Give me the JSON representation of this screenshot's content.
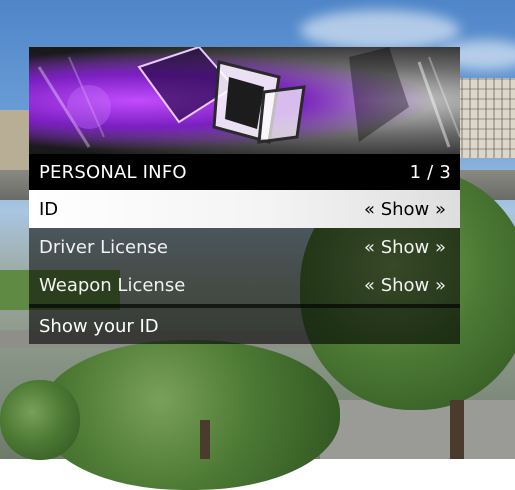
{
  "menu": {
    "title": "PERSONAL INFO",
    "counter": "1 / 3",
    "items": [
      {
        "label": "ID",
        "value": "« Show »",
        "selected": true
      },
      {
        "label": "Driver License",
        "value": "« Show »",
        "selected": false
      },
      {
        "label": "Weapon License",
        "value": "« Show »",
        "selected": false
      }
    ],
    "description": "Show your ID"
  },
  "colors": {
    "banner_purple": "#8b2fd6",
    "header_bg": "#000000",
    "selected_bg": "#ffffff"
  }
}
